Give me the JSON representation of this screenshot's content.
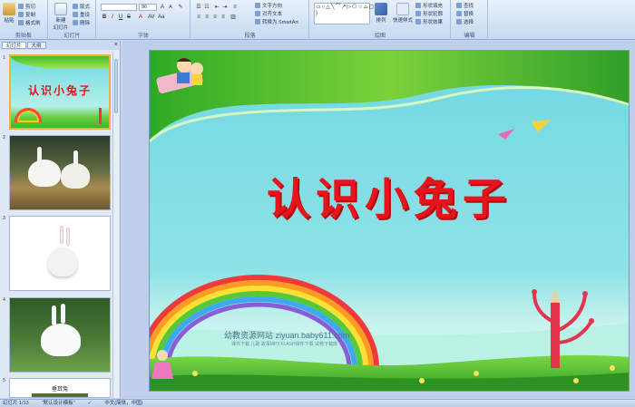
{
  "ribbon": {
    "clipboard": {
      "label": "剪贴板",
      "paste": "粘贴",
      "cut": "剪切",
      "copy": "复制",
      "format_painter": "格式刷"
    },
    "slides": {
      "label": "幻灯片",
      "new_slide": "新建\n幻灯片",
      "layout": "版式",
      "reset": "重设",
      "delete": "删除"
    },
    "font": {
      "label": "字体",
      "size": "96",
      "bold": "B",
      "italic": "I",
      "underline": "U",
      "strike": "S"
    },
    "paragraph": {
      "label": "段落",
      "text_direction": "文字方向",
      "align_text": "对齐文本",
      "smartart": "转换为 SmartArt"
    },
    "drawing": {
      "label": "绘图",
      "arrange": "排列",
      "quick_styles": "快速样式",
      "shape_fill": "形状填充",
      "shape_outline": "形状轮廓",
      "shape_effects": "形状效果"
    },
    "editing": {
      "label": "编辑",
      "find": "查找",
      "replace": "替换",
      "select": "选择"
    }
  },
  "left_pane": {
    "tab_slides": "幻灯片",
    "tab_outline": "大纲",
    "slide_numbers": [
      "1",
      "2",
      "3",
      "4",
      "5"
    ],
    "slide5_caption": "垂耳兔"
  },
  "slide": {
    "title": "认识小兔子",
    "watermark_site": "幼教资源网站  ziyuan.baby611.com",
    "watermark_sub": "课件下载  儿歌  故事MP3  FLASH课件下载  试卷下载库"
  },
  "thumb1_title": "认识小兔子",
  "status": {
    "slide_counter": "幻灯片 1/13",
    "theme": "\"默认设计模板\"",
    "language": "中文(简体，中国)"
  },
  "colors": {
    "title_red": "#e8141b",
    "sky_cyan": "#6fd8e3",
    "grass_green": "#3fb52c"
  }
}
